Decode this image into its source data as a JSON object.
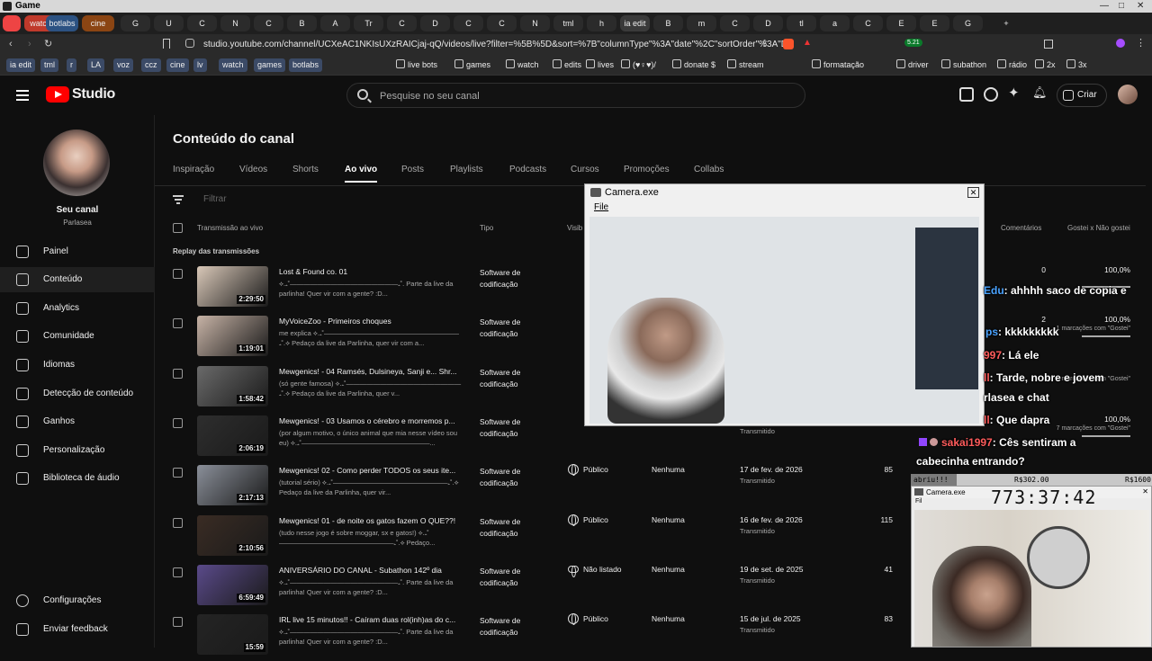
{
  "os": {
    "title": "Game"
  },
  "tabs": [
    {
      "label": "",
      "color": "#e44"
    },
    {
      "label": "watch",
      "color": "#c0392b"
    },
    {
      "label": "botlabs",
      "color": "#2c5282"
    },
    {
      "label": "cine",
      "color": "#8b4513"
    },
    {
      "label": "G"
    },
    {
      "label": "U"
    },
    {
      "label": "C"
    },
    {
      "label": "N"
    },
    {
      "label": "C"
    },
    {
      "label": "B"
    },
    {
      "label": "A"
    },
    {
      "label": "Tr"
    },
    {
      "label": "C"
    },
    {
      "label": "D"
    },
    {
      "label": "C"
    },
    {
      "label": "C"
    },
    {
      "label": "N"
    },
    {
      "label": "tml"
    },
    {
      "label": "h"
    },
    {
      "label": "ia edit"
    },
    {
      "label": "B"
    },
    {
      "label": "m"
    },
    {
      "label": "C"
    },
    {
      "label": "D"
    },
    {
      "label": "tl"
    },
    {
      "label": "a"
    },
    {
      "label": "C"
    },
    {
      "label": "E"
    },
    {
      "label": "E"
    },
    {
      "label": "G"
    }
  ],
  "address": {
    "url": "studio.youtube.com/channel/UCXeAC1NKIsUXzRAICjaj-qQ/videos/live?filter=%5B%5D&sort=%7B\"columnType\"%3A\"date\"%2C\"sortOrder\"%3A\"D...",
    "badge": "5.21"
  },
  "bookmarks": [
    "ia edit",
    "tml",
    "r",
    "LA",
    "voz",
    "ccz",
    "cine",
    "lv",
    "watch",
    "games",
    "botlabs",
    "live bots",
    "games",
    "watch",
    "edits",
    "lives",
    "(♥♀♥)/",
    "donate $",
    "stream",
    "formatação",
    "driver",
    "subathon",
    "rádio",
    "2x",
    "3x"
  ],
  "studio": {
    "logo": "Studio",
    "search_placeholder": "Pesquise no seu canal",
    "create_label": "Criar"
  },
  "sidebar": {
    "channel_title": "Seu canal",
    "channel_name": "Parlasea",
    "items": [
      {
        "label": "Painel",
        "icon": "dashboard-icon"
      },
      {
        "label": "Conteúdo",
        "icon": "content-icon"
      },
      {
        "label": "Analytics",
        "icon": "analytics-icon"
      },
      {
        "label": "Comunidade",
        "icon": "community-icon"
      },
      {
        "label": "Idiomas",
        "icon": "subtitles-icon"
      },
      {
        "label": "Detecção de conteúdo",
        "icon": "copyright-icon"
      },
      {
        "label": "Ganhos",
        "icon": "money-icon"
      },
      {
        "label": "Personalização",
        "icon": "customize-icon"
      },
      {
        "label": "Biblioteca de áudio",
        "icon": "audio-library-icon"
      }
    ],
    "settings": "Configurações",
    "feedback": "Enviar feedback"
  },
  "main": {
    "title": "Conteúdo do canal",
    "tabs": [
      "Inspiração",
      "Vídeos",
      "Shorts",
      "Ao vivo",
      "Posts",
      "Playlists",
      "Podcasts",
      "Cursos",
      "Promoções",
      "Collabs"
    ],
    "filter": "Filtrar",
    "columns": {
      "title": "Transmissão ao vivo",
      "type": "Tipo",
      "visibility": "Visib",
      "comments": "Comentários",
      "likes": "Gostei x Não gostei"
    },
    "section": "Replay das transmissões",
    "rows": [
      {
        "title": "Lost & Found co. 01",
        "desc": "⟡.₊˚————————————————₊˚. Parte da live da parlinha! Quer vir com a gente? :D...",
        "duration": "2:29:50",
        "type": "Software de codificação",
        "visibility": "",
        "restriction": "",
        "date": "",
        "status": "",
        "views": "",
        "comments": "0",
        "ratio": "100,0%",
        "ratio_sub": ""
      },
      {
        "title": "MyVoiceZoo - Primeiros choques",
        "desc": "me explica ⟡.₊˚————————————————————₊˚.⟡ Pedaço da live da Parlinha, quer vir com a...",
        "duration": "1:19:01",
        "type": "Software de codificação",
        "visibility": "",
        "restriction": "",
        "date": "",
        "status": "",
        "views": "",
        "comments": "2",
        "ratio": "100,0%",
        "ratio_sub": "1 marcações com \"Gostei\""
      },
      {
        "title": "Mewgenics! - 04 Ramsés, Dulsineya, Sanji e... Shr...",
        "desc": "(só gente famosa) ⟡.₊˚—————————————————₊˚.⟡ Pedaço da live da Parlinha, quer v...",
        "duration": "1:58:42",
        "type": "Software de codificação",
        "visibility": "",
        "restriction": "",
        "date": "",
        "status": "",
        "views": "",
        "comments": "",
        "ratio": "",
        "ratio_sub": "9 marcações com \"Gostei\""
      },
      {
        "title": "Mewgenics! - 03 Usamos o cérebro e morremos p...",
        "desc": "(por algum motivo, o único animal que mia nesse vídeo sou eu) ⟡.₊˚———————————————————...",
        "duration": "2:06:19",
        "type": "Software de codificação",
        "visibility": "",
        "restriction": "",
        "date": "",
        "status": "Transmitido",
        "views": "",
        "comments": "",
        "ratio": "100,0%",
        "ratio_sub": "7 marcações com \"Gostei\""
      },
      {
        "title": "Mewgenics! 02 - Como perder TODOS os seus ite...",
        "desc": "(tutorial sério) ⟡.₊˚—————————————————₊˚.⟡ Pedaço da live da Parlinha, quer vir...",
        "duration": "2:17:13",
        "type": "Software de codificação",
        "visibility": "Público",
        "restriction": "Nenhuma",
        "date": "17 de fev. de 2026",
        "status": "Transmitido",
        "views": "85",
        "comments": "",
        "ratio": "",
        "ratio_sub": ""
      },
      {
        "title": "Mewgenics! 01 - de noite os gatos fazem O QUE??!",
        "desc": "(tudo nesse jogo é sobre moggar, sx e gatos!) ⟡.₊˚—————————————————₊˚.⟡ Pedaço...",
        "duration": "2:10:56",
        "type": "Software de codificação",
        "visibility": "Público",
        "restriction": "Nenhuma",
        "date": "16 de fev. de 2026",
        "status": "Transmitido",
        "views": "115",
        "comments": "",
        "ratio": "",
        "ratio_sub": ""
      },
      {
        "title": "ANIVERSÁRIO DO CANAL - Subathon 142º dia",
        "desc": "⟡.₊˚————————————————₊˚. Parte da live da parlinha! Quer vir com a gente? :D...",
        "duration": "6:59:49",
        "type": "Software de codificação",
        "visibility": "Não listado",
        "restriction": "Nenhuma",
        "date": "19 de set. de 2025",
        "status": "Transmitido",
        "views": "41",
        "comments": "",
        "ratio": "",
        "ratio_sub": ""
      },
      {
        "title": "IRL live 15 minutos!! - Caíram duas rol(inh)as do c...",
        "desc": "⟡.₊˚————————————————₊˚. Parte da live da parlinha! Quer vir com a gente? :D...",
        "duration": "15:59",
        "type": "Software de codificação",
        "visibility": "Público",
        "restriction": "Nenhuma",
        "date": "15 de jul. de 2025",
        "status": "Transmitido",
        "views": "83",
        "comments": "",
        "ratio": "",
        "ratio_sub": ""
      }
    ]
  },
  "overlay": {
    "camera_title": "Camera.exe",
    "camera_menu": "File",
    "camera2_title": "Camera.exe",
    "camera2_menu": "Fil",
    "timer": "773:37:42",
    "goal_label": "abriu!!!",
    "goal_current": "R$302.00",
    "goal_target": "R$1600",
    "goal_progress": 0.19,
    "chat": [
      {
        "user": "Edu",
        "msg": ": ahhhh saco de copia e",
        "color": "#4aa3ff"
      },
      {
        "user": "ps",
        "msg": ": kkkkkkkkk",
        "color": "#4aa3ff"
      },
      {
        "user": "997",
        "msg": ": Lá ele",
        "color": "#ff5c5c"
      },
      {
        "user": "ll",
        "msg": ": Tarde, nobre e jovem",
        "color": "#ff5c5c"
      },
      {
        "user": "",
        "msg": "rlasea e chat",
        "color": "#fff"
      },
      {
        "user": "ll",
        "msg": ": Que dapra",
        "color": "#ff5c5c"
      },
      {
        "user": "sakai1997",
        "msg": ": Cês sentiram a",
        "color": "#ff5c5c"
      },
      {
        "user": "",
        "msg": "cabecinha entrando?",
        "color": "#fff"
      }
    ],
    "ratio_small": "1 marcações com \"Gostei\""
  }
}
